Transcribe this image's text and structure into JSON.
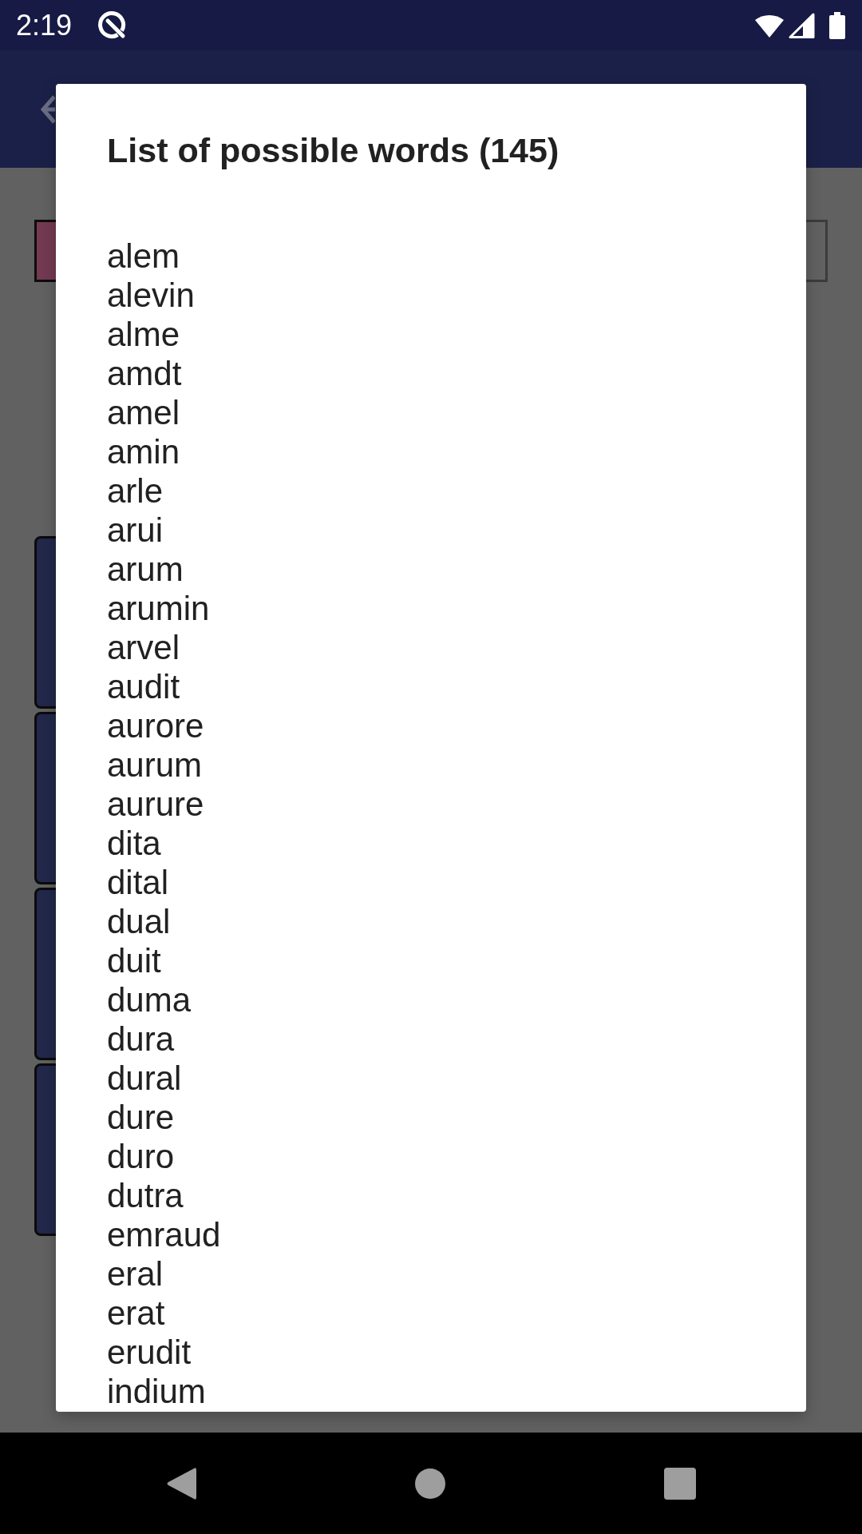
{
  "status_bar": {
    "time": "2:19"
  },
  "dialog": {
    "title": "List of possible words (145)",
    "words": [
      "alem",
      "alevin",
      "alme",
      "amdt",
      "amel",
      "amin",
      "arle",
      "arui",
      "arum",
      "arumin",
      "arvel",
      "audit",
      "aurore",
      "aurum",
      "aurure",
      "dita",
      "dital",
      "dual",
      "duit",
      "duma",
      "dura",
      "dural",
      "dure",
      "duro",
      "dutra",
      "emraud",
      "eral",
      "erat",
      "erudit",
      "indium"
    ]
  }
}
